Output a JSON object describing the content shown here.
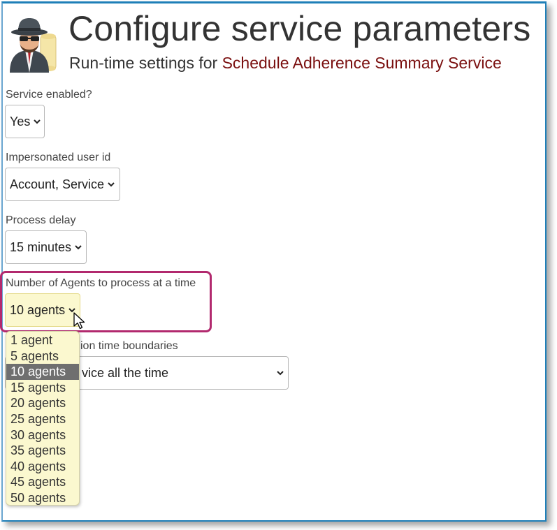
{
  "header": {
    "title": "Configure service parameters",
    "subtitle_prefix": "Run-time settings for ",
    "service_name": "Schedule Adherence Summary Service"
  },
  "fields": {
    "service_enabled": {
      "label": "Service enabled?",
      "value": "Yes"
    },
    "impersonated_user": {
      "label": "Impersonated user id",
      "value": "Account, Service"
    },
    "process_delay": {
      "label": "Process delay",
      "value": "15 minutes"
    },
    "agents_per_batch": {
      "label": "Number of Agents to process at a time",
      "value": "10 agents",
      "options": [
        "1 agent",
        "5 agents",
        "10 agents",
        "15 agents",
        "20 agents",
        "25 agents",
        "30 agents",
        "35 agents",
        "40 agents",
        "45 agents",
        "50 agents"
      ],
      "selected_index": 2
    },
    "time_boundaries": {
      "label_partial": "ion time boundaries",
      "value_partial": "vice all the time"
    }
  },
  "colors": {
    "accent_frame": "#1e7fb8",
    "highlight": "#b2296e",
    "service_name": "#7a0f0f",
    "dropdown_bg": "#fbf8cf",
    "selected_option": "#6f6f6f"
  },
  "icons": [
    "spy-agent-icon",
    "chevron-down-icon",
    "mouse-pointer-icon"
  ]
}
